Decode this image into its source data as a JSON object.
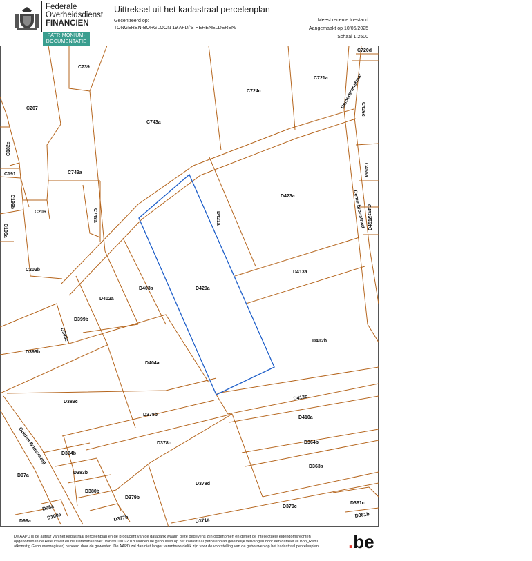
{
  "header": {
    "agency_line1": "Federale",
    "agency_line2": "Overheidsdienst",
    "agency_line3": "FINANCIEN",
    "department_line1": "PATRIMONIUM-",
    "department_line2": "DOCUMENTATIE",
    "title": "Uittreksel uit het kadastraal percelenplan",
    "centered_label": "Gecentreerd op:",
    "centered_value": "TONGEREN-BORGLOON 19 AFD/'S HERENELDEREN/",
    "recency": "Meest recente toestand",
    "created": "Aangemaakt op 10/06/2025",
    "scale": "Schaal 1:2500"
  },
  "map": {
    "parcels": [
      "C720d",
      "C739",
      "C724c",
      "C721a",
      "C207",
      "C743a",
      "C426c",
      "C182e",
      "D423a",
      "C191",
      "C749a",
      "C455a",
      "C196b",
      "C206",
      "C748a",
      "D421a",
      "C452a",
      "C195a",
      "D451a",
      "C202b",
      "D413a",
      "D403a",
      "D420a",
      "D402a",
      "D399b",
      "D399c",
      "D412b",
      "D393b",
      "D404a",
      "D389c",
      "D412c",
      "D378b",
      "D410a",
      "D378c",
      "D384b",
      "D364b",
      "D97a",
      "D383b",
      "D363a",
      "D380b",
      "D378d",
      "D379b",
      "D361c",
      "D98a",
      "D370c",
      "D99a",
      "D100a",
      "D377b",
      "D371a",
      "D361b"
    ],
    "streets": [
      "Demerbronstraat",
      "Demerbronstraat",
      "Gulden-Bodemweg"
    ],
    "selected_parcel": "D420a"
  },
  "footer": {
    "disclaimer": "De AAPD is de auteur van het kadastraal percelenplan en de producent van de databank waarin deze gegevens zijn opgenomen en geniet de intellectuele eigendomsrechten opgenomen in de Auteurswet en de Databankenwet. Vanaf 01/01/2018 worden de gebouwen op het kadastraal percelenplan geleidelijk vervangen door een dataset (= Bpn_Rebu afkomstig Gebouwenregister) beheerd door de gewesten. De AAPD zal dan niet langer verantwoordelijk zijn voor de voorstelling van de gebouwen op het kadastraal percelenplan",
    "logo_text": "be",
    "logo_dot": "."
  }
}
